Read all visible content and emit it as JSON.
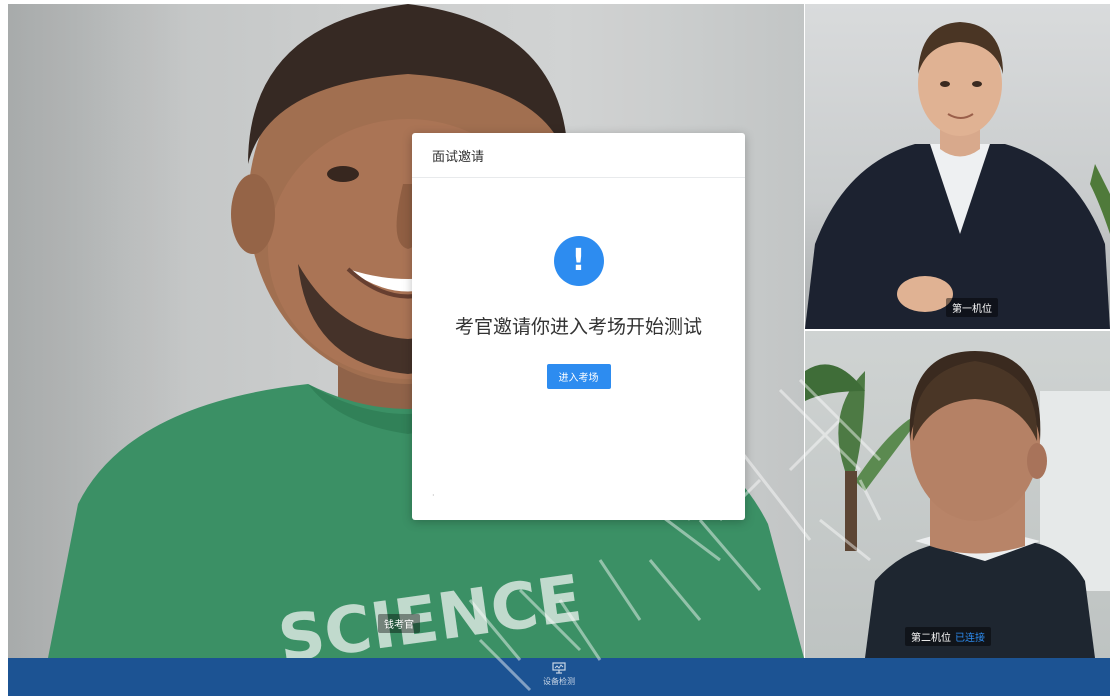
{
  "modal": {
    "title": "面试邀请",
    "icon": "exclamation-icon",
    "icon_glyph": "!",
    "message": "考官邀请你进入考场开始测试",
    "enter_button_label": "进入考场",
    "dot": "·"
  },
  "videos": {
    "main_label": "钱考官",
    "camera_one_label": "第一机位",
    "camera_two_label": "第二机位",
    "camera_two_status": "已连接",
    "shirt_text": "SCIENCE"
  },
  "bottom_bar": {
    "device_check_label": "设备检测",
    "device_check_icon": "monitor-icon"
  },
  "colors": {
    "accent": "#2d8cf0",
    "bottom_bar": "#1c5393",
    "status_connected": "#2d8cf0"
  }
}
